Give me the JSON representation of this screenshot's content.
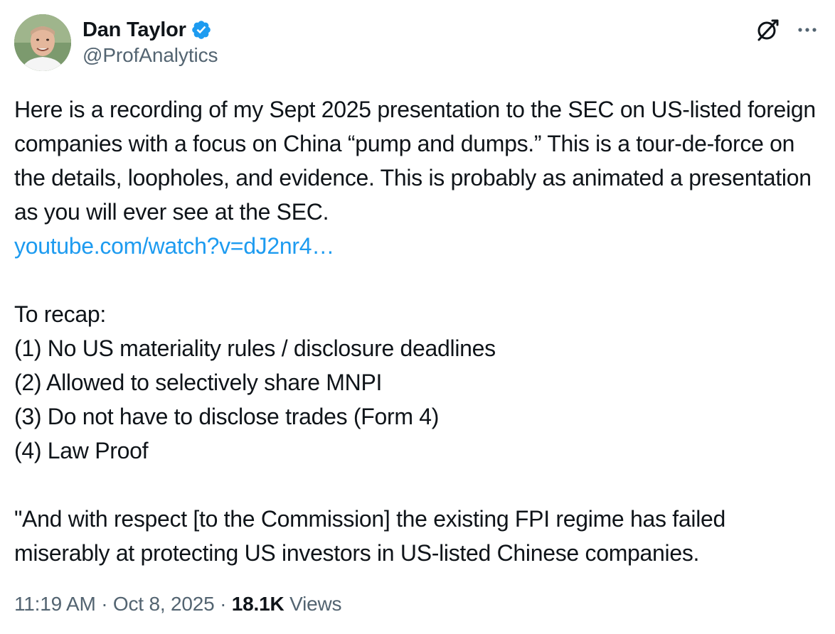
{
  "author": {
    "display_name": "Dan Taylor",
    "handle": "@ProfAnalytics",
    "verified": true,
    "verified_color": "#1d9bf0"
  },
  "icons": {
    "grok": "grok-icon",
    "more": "more-icon"
  },
  "tweet": {
    "paragraph1": "Here is a recording of my Sept 2025 presentation to the SEC on US-listed foreign companies with a focus on China “pump and dumps.” This is a tour-de-force on the details, loopholes, and evidence. This is probably as animated a presentation as you will ever see at the SEC.",
    "link_text": "youtube.com/watch?v=dJ2nr4…",
    "recap_title": "To recap:",
    "recap_items": [
      "(1) No US materiality rules / disclosure deadlines",
      "(2) Allowed to selectively share MNPI",
      "(3) Do not have to disclose trades (Form 4)",
      "(4) Law Proof"
    ],
    "quote": "\"And with respect [to the Commission] the existing FPI regime has failed miserably at protecting US investors in US-listed Chinese companies."
  },
  "meta": {
    "time": "11:19 AM",
    "separator": " · ",
    "date": "Oct 8, 2025",
    "views_count": "18.1K",
    "views_label": "Views"
  },
  "colors": {
    "text": "#0f1419",
    "secondary": "#536471",
    "link": "#1d9bf0"
  }
}
